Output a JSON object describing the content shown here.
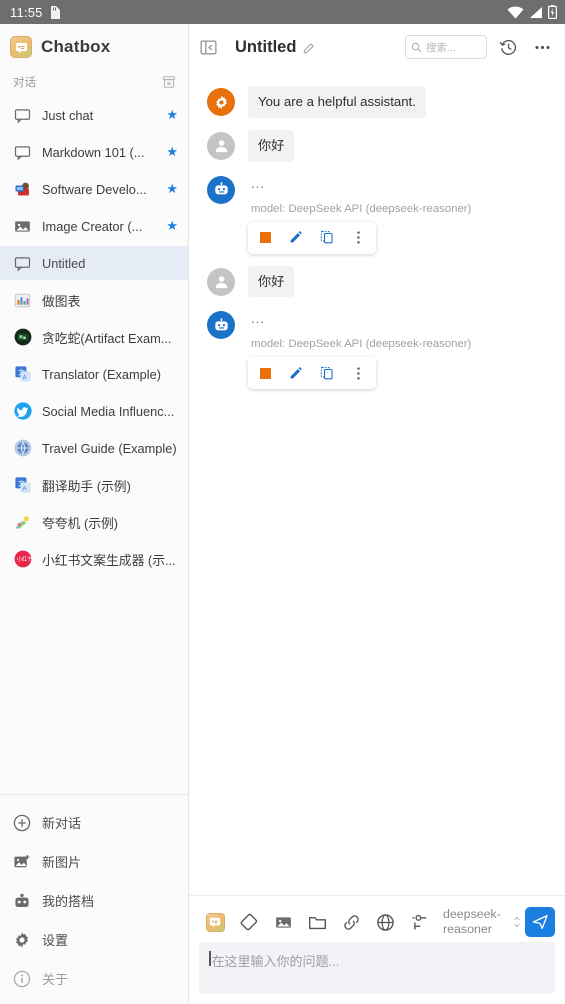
{
  "statusbar": {
    "time": "11:55",
    "icons": [
      "sd-card-icon",
      "wifi-icon",
      "signal-icon",
      "battery-charging-icon"
    ]
  },
  "sidebar": {
    "brand": {
      "name": "Chatbox",
      "logo_icon": "chatbox-logo-icon",
      "logo_color": "#eeb96a"
    },
    "section_label": "对话",
    "clear_icon": "archive-clear-icon",
    "conversations": [
      {
        "label": "Just chat",
        "icon": "chat-bubble-icon",
        "starred": true,
        "selected": false
      },
      {
        "label": "Markdown 101 (...",
        "icon": "chat-bubble-icon",
        "starred": true,
        "selected": false
      },
      {
        "label": "Software Develo...",
        "icon": "developer-avatar-icon",
        "starred": true,
        "selected": false
      },
      {
        "label": "Image Creator (...",
        "icon": "image-icon",
        "starred": true,
        "selected": false
      },
      {
        "label": "Untitled",
        "icon": "chat-bubble-icon",
        "starred": false,
        "selected": true
      },
      {
        "label": "做图表",
        "icon": "chart-icon",
        "starred": false,
        "selected": false
      },
      {
        "label": "贪吃蛇(Artifact Exam...",
        "icon": "snake-avatar-icon",
        "starred": false,
        "selected": false
      },
      {
        "label": "Translator (Example)",
        "icon": "translate-icon",
        "starred": false,
        "selected": false
      },
      {
        "label": "Social Media Influenc...",
        "icon": "twitter-icon",
        "starred": false,
        "selected": false
      },
      {
        "label": "Travel Guide (Example)",
        "icon": "globe-avatar-icon",
        "starred": false,
        "selected": false
      },
      {
        "label": "翻译助手 (示例)",
        "icon": "translate-icon",
        "starred": false,
        "selected": false
      },
      {
        "label": "夸夸机 (示例)",
        "icon": "praise-avatar-icon",
        "starred": false,
        "selected": false
      },
      {
        "label": "小红书文案生成器 (示...",
        "icon": "xiaohongshu-icon",
        "starred": false,
        "selected": false
      }
    ],
    "footer_items": [
      {
        "label": "新对话",
        "icon": "plus-circle-icon",
        "muted": false
      },
      {
        "label": "新图片",
        "icon": "new-image-icon",
        "muted": false
      },
      {
        "label": "我的搭档",
        "icon": "my-copilot-icon",
        "muted": false
      },
      {
        "label": "设置",
        "icon": "gear-icon",
        "muted": false
      },
      {
        "label": "关于",
        "icon": "info-icon",
        "muted": true
      }
    ]
  },
  "topbar": {
    "collapse_icon": "collapse-sidebar-icon",
    "title": "Untitled",
    "edit_icon": "pencil-icon",
    "search_placeholder": "搜索...",
    "search_icon": "search-icon",
    "history_icon": "history-icon",
    "more_icon": "more-horizontal-icon"
  },
  "messages": [
    {
      "role": "system",
      "avatar_icon": "gear-avatar-icon",
      "avatar_color": "#e8710a",
      "text": "You are a helpful assistant.",
      "model_line": null,
      "toolbar": null
    },
    {
      "role": "user",
      "avatar_icon": "person-avatar-icon",
      "avatar_color": "#c4c4c4",
      "text": "你好",
      "model_line": null,
      "toolbar": null
    },
    {
      "role": "assistant",
      "avatar_icon": "robot-avatar-icon",
      "avatar_color": "#1a73c8",
      "text": "...",
      "model_line": "model: DeepSeek API (deepseek-reasoner)",
      "toolbar": [
        "stop-icon",
        "edit-icon",
        "copy-icon",
        "more-vertical-icon"
      ]
    },
    {
      "role": "user",
      "avatar_icon": "person-avatar-icon",
      "avatar_color": "#c4c4c4",
      "text": "你好",
      "model_line": null,
      "toolbar": null
    },
    {
      "role": "assistant",
      "avatar_icon": "robot-avatar-icon",
      "avatar_color": "#1a73c8",
      "text": "...",
      "model_line": "model: DeepSeek API (deepseek-reasoner)",
      "toolbar": [
        "stop-icon",
        "edit-icon",
        "copy-icon",
        "more-vertical-icon"
      ]
    }
  ],
  "composer": {
    "tools": [
      "chatbox-mini-icon",
      "eraser-icon",
      "image-icon",
      "folder-icon",
      "link-icon",
      "globe-icon",
      "tune-icon"
    ],
    "model_name": "deepseek-reasoner",
    "model_chevron_icon": "chevron-updown-icon",
    "send_icon": "send-icon",
    "send_color": "#1b7fe0",
    "input_placeholder": "在这里输入你的问题..."
  }
}
